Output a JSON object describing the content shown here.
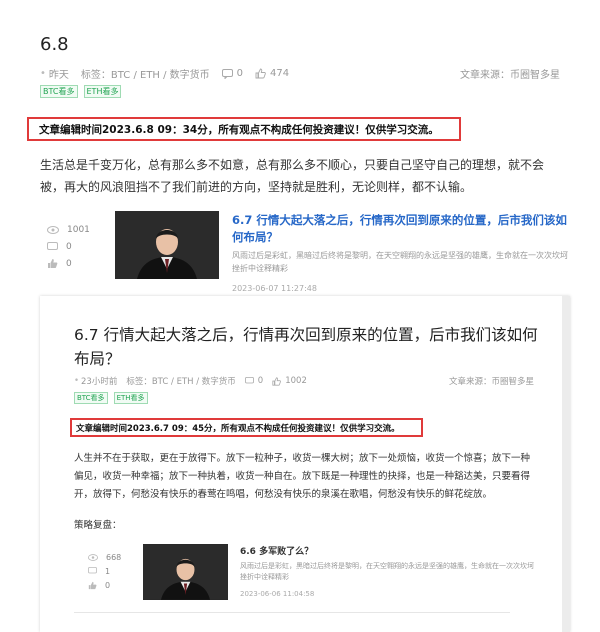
{
  "article": {
    "title": "6.8",
    "time": "昨天",
    "tags_label": "标签：BTC / ETH / 数字货币",
    "comments": "0",
    "likes": "474",
    "source": "文章来源：币圈智多星",
    "tags": [
      "BTC看多",
      "ETH看多"
    ],
    "notice": "文章编辑时间2023.6.8  09：34分，所有观点不构成任何投资建议！仅供学习交流。",
    "body": "生活总是千变万化，总有那么多不如意，总有那么多不顺心，只要自己坚守自己的理想，就不会被，再大的风浪阻挡不了我们前进的方向，坚持就是胜利，无论则样，都不认输。"
  },
  "related": {
    "views": "1001",
    "comments": "0",
    "likes": "0",
    "title": "6.7 行情大起大落之后，行情再次回到原来的位置，后市我们该如何布局？",
    "excerpt": "风雨过后是彩虹，黑暗过后终将是黎明，在天空翱翔的永远是坚强的雄鹰，生命就在一次次坎坷挫折中诠释精彩",
    "date": "2023-06-07 11:27:48"
  },
  "inner": {
    "title": "6.7 行情大起大落之后，行情再次回到原来的位置，后市我们该如何布局？",
    "time": "23小时前",
    "tags_label": "标签：BTC / ETH / 数字货币",
    "comments": "0",
    "likes": "1002",
    "source": "文章来源：币圈智多星",
    "tags": [
      "BTC看多",
      "ETH看多"
    ],
    "notice": "文章编辑时间2023.6.7  09：45分，所有观点不构成任何投资建议！仅供学习交流。",
    "body": "人生并不在于获取，更在于放得下。放下一粒种子，收货一棵大树；放下一处烦恼，收货一个惊喜；放下一种偏见，收货一种幸福；放下一种执着，收货一种自在。放下既是一种理性的抉择，也是一种豁达美，只要看得开，放得下，何愁没有快乐的春莺在鸣唱，何愁没有快乐的泉溪在歌唱，何愁没有快乐的鲜花绽放。",
    "section": "策略复盘：",
    "related": {
      "views": "668",
      "comments": "1",
      "likes": "0",
      "title": "6.6 多军败了么？",
      "excerpt": "风雨过后是彩虹，黑暗过后终将是黎明，在天空翱翔的永远是坚强的雄鹰，生命就在一次次坎坷挫折中诠释精彩",
      "date": "2023-06-06 11:04:58"
    }
  },
  "colors": {
    "notice_border": "#e03a3a",
    "link": "#2768c8",
    "tag": "#21a452"
  }
}
